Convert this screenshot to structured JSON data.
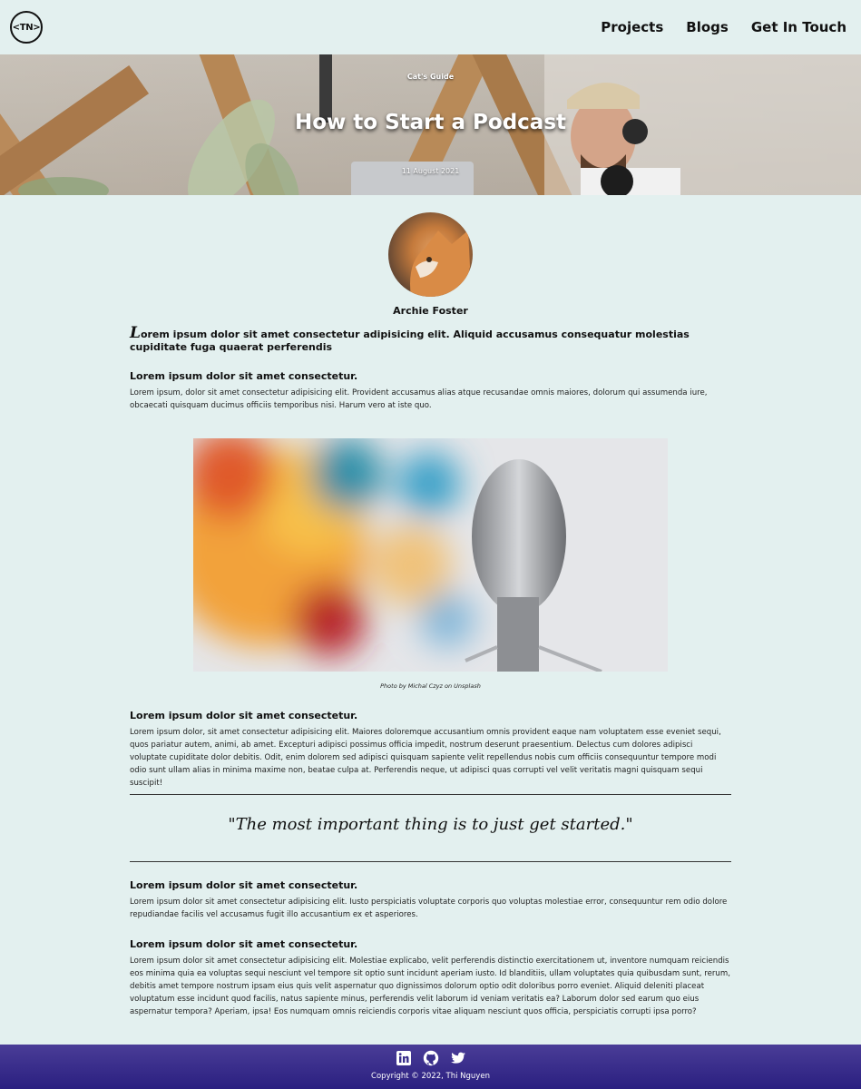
{
  "header": {
    "logo_text": "<TN>",
    "nav": [
      "Projects",
      "Blogs",
      "Get In Touch"
    ]
  },
  "hero": {
    "category": "Cat's Guide",
    "title": "How to Start a Podcast",
    "date": "11 August 2021"
  },
  "author": {
    "name": "Archie Foster"
  },
  "article": {
    "lead_initial": "L",
    "lead_rest": "orem ipsum dolor sit amet consectetur adipisicing elit. Aliquid accusamus consequatur molestias cupiditate fuga quaerat perferendis",
    "sections": [
      {
        "heading": "Lorem ipsum dolor sit amet consectetur.",
        "text": "Lorem ipsum, dolor sit amet consectetur adipisicing elit. Provident accusamus alias atque recusandae omnis maiores, dolorum qui assumenda iure, obcaecati quisquam ducimus officiis temporibus nisi. Harum vero at iste quo."
      },
      {
        "heading": "Lorem ipsum dolor sit amet consectetur.",
        "text": "Lorem ipsum dolor, sit amet consectetur adipisicing elit. Maiores doloremque accusantium omnis provident eaque nam voluptatem esse eveniet sequi, quos pariatur autem, animi, ab amet. Excepturi adipisci possimus officia impedit, nostrum deserunt praesentium. Delectus cum dolores adipisci voluptate cupiditate dolor debitis. Odit, enim dolorem sed adipisci quisquam sapiente velit repellendus nobis cum officiis consequuntur tempore modi odio sunt ullam alias in minima maxime non, beatae culpa at. Perferendis neque, ut adipisci quas corrupti vel velit veritatis magni quisquam sequi suscipit!"
      },
      {
        "heading": "Lorem ipsum dolor sit amet consectetur.",
        "text": "Lorem ipsum dolor sit amet consectetur adipisicing elit. Iusto perspiciatis voluptate corporis quo voluptas molestiae error, consequuntur rem odio dolore repudiandae facilis vel accusamus fugit illo accusantium ex et asperiores."
      },
      {
        "heading": "Lorem ipsum dolor sit amet consectetur.",
        "text": "Lorem ipsum dolor sit amet consectetur adipisicing elit. Molestiae explicabo, velit perferendis distinctio exercitationem ut, inventore numquam reiciendis eos minima quia ea voluptas sequi nesciunt vel tempore sit optio sunt incidunt aperiam iusto. Id blanditiis, ullam voluptates quia quibusdam sunt, rerum, debitis amet tempore nostrum ipsam eius quis velit aspernatur quo dignissimos dolorum optio odit doloribus porro eveniet. Aliquid deleniti placeat voluptatum esse incidunt quod facilis, natus sapiente minus, perferendis velit laborum id veniam veritatis ea? Laborum dolor sed earum quo eius aspernatur tempora? Aperiam, ipsa! Eos numquam omnis reiciendis corporis vitae aliquam nesciunt quos officia, perspiciatis corrupti ipsa porro?"
      }
    ],
    "photo_caption": "Photo by Michal Czyz on Unsplash",
    "quote": "\"The most important thing is to just get started.\""
  },
  "footer": {
    "icons": [
      "linkedin-icon",
      "github-icon",
      "twitter-icon"
    ],
    "copyright": "Copyright © 2022, Thi Nguyen"
  },
  "colors": {
    "background": "#e3f0ef",
    "footer": "#2a1f80"
  }
}
